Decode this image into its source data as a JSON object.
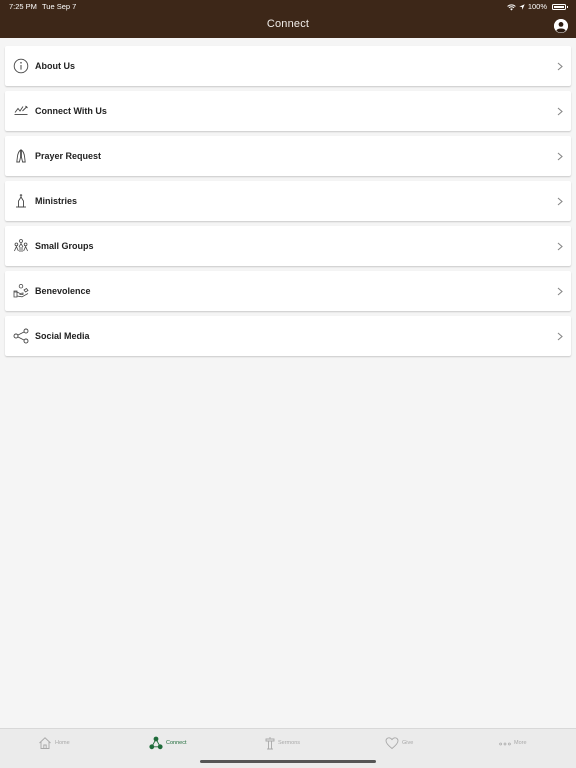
{
  "status_bar": {
    "time": "7:25 PM",
    "date": "Tue Sep 7",
    "battery": "100%"
  },
  "header": {
    "title": "Connect"
  },
  "menu": [
    {
      "label": "About Us",
      "icon": "info-icon"
    },
    {
      "label": "Connect With Us",
      "icon": "sign-icon"
    },
    {
      "label": "Prayer Request",
      "icon": "praying-hands-icon"
    },
    {
      "label": "Ministries",
      "icon": "church-icon"
    },
    {
      "label": "Small Groups",
      "icon": "group-icon"
    },
    {
      "label": "Benevolence",
      "icon": "helping-hand-icon"
    },
    {
      "label": "Social Media",
      "icon": "share-icon"
    }
  ],
  "tabs": [
    {
      "label": "Home",
      "icon": "home-icon",
      "active": false
    },
    {
      "label": "Connect",
      "icon": "connect-icon",
      "active": true
    },
    {
      "label": "Sermons",
      "icon": "pulpit-icon",
      "active": false
    },
    {
      "label": "Give",
      "icon": "heart-icon",
      "active": false
    },
    {
      "label": "More",
      "icon": "more-icon",
      "active": false
    }
  ],
  "colors": {
    "header_bg": "#3d2718",
    "active_tab": "#1f6b3a",
    "inactive_tab": "#a8a8a8",
    "background": "#f5f5f5"
  }
}
